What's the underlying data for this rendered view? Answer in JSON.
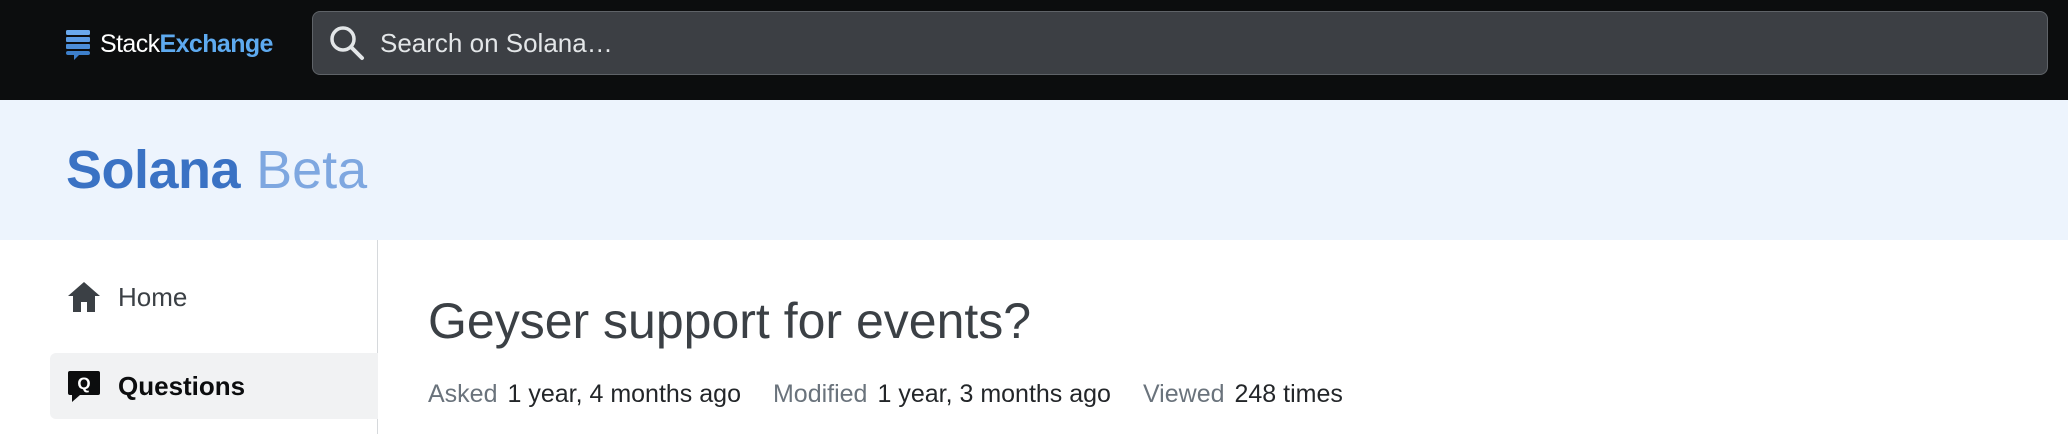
{
  "topbar": {
    "brand": {
      "stack": "Stack",
      "exchange": "Exchange",
      "icon": "stack-exchange-logo-icon"
    },
    "search": {
      "placeholder": "Search on Solana…",
      "value": "",
      "icon": "search-icon"
    }
  },
  "site": {
    "name": "Solana",
    "badge": "Beta"
  },
  "sidebar": {
    "items": [
      {
        "label": "Home",
        "icon": "home-icon",
        "active": false
      },
      {
        "label": "Questions",
        "icon": "questions-icon",
        "active": true
      }
    ]
  },
  "question": {
    "title": "Geyser support for events?",
    "asked_label": "Asked",
    "asked_value": "1 year, 4 months ago",
    "modified_label": "Modified",
    "modified_value": "1 year, 3 months ago",
    "viewed_label": "Viewed",
    "viewed_value": "248 times"
  },
  "colors": {
    "topbar_bg": "#0c0d0e",
    "accent_blue": "#3a72c4",
    "beta_blue": "#7ea7e0",
    "exchange_blue": "#5eaaf0",
    "header_bg": "#edf4fd",
    "active_nav_bg": "#f1f2f3"
  }
}
